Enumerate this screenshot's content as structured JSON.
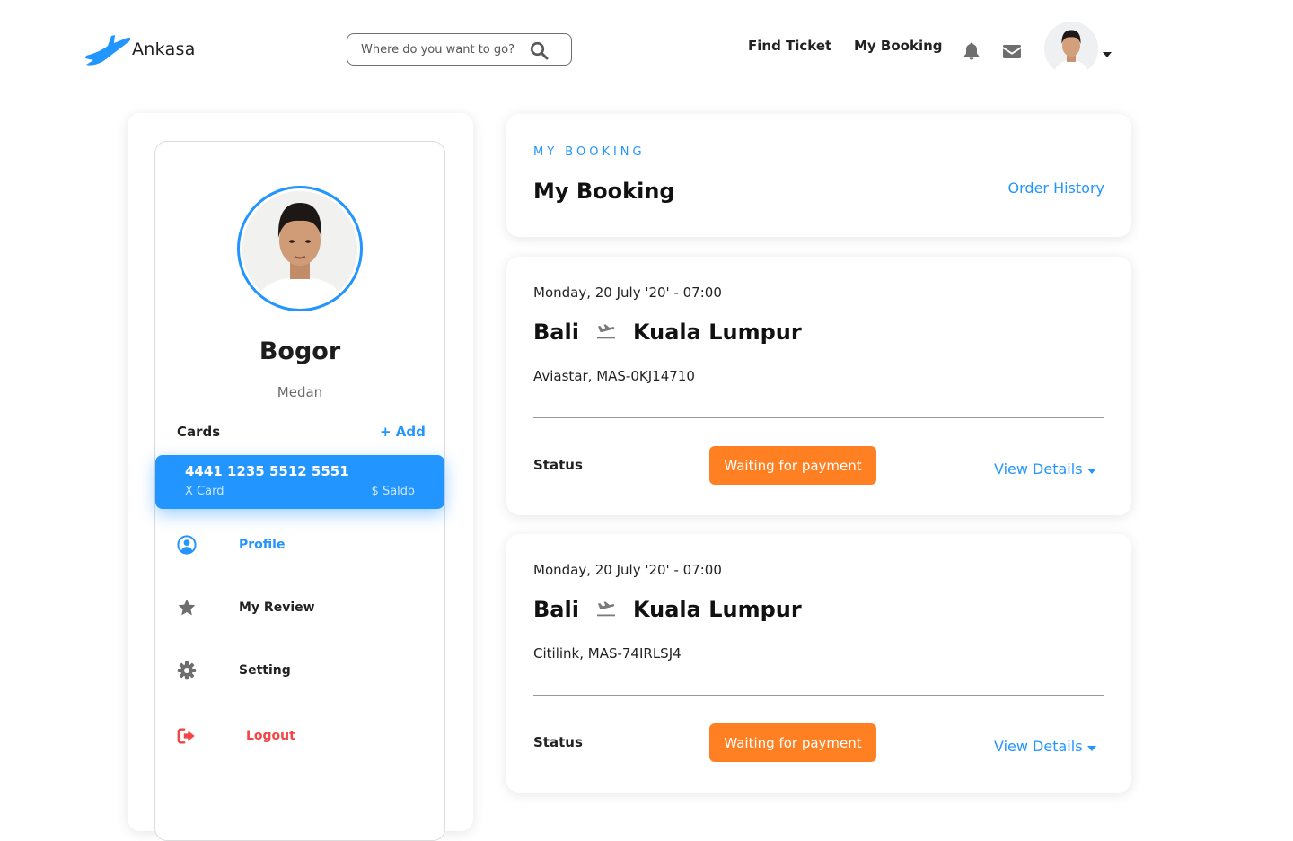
{
  "app": {
    "name": "Ankasa",
    "accent": "#2395ff",
    "status_color": "#ff7f23",
    "logout_color": "#f24545"
  },
  "search": {
    "placeholder": "Where do you want to go?",
    "icon": "search-icon"
  },
  "nav": {
    "find_ticket": "Find Ticket",
    "my_booking": "My Booking"
  },
  "header_icons": [
    "bell-icon",
    "mail-icon",
    "chevron-down-icon"
  ],
  "profile": {
    "name": "Bogor",
    "city": "Medan",
    "cards_label": "Cards",
    "add_label": "+ Add",
    "card": {
      "number": "4441 1235 5512 5551",
      "type": "X Card",
      "balance_label": "$ Saldo"
    }
  },
  "menu": [
    {
      "label": "Profile",
      "icon": "user-circle-icon"
    },
    {
      "label": "My Review",
      "icon": "star-icon"
    },
    {
      "label": "Setting",
      "icon": "gear-icon"
    },
    {
      "label": "Logout",
      "icon": "logout-icon"
    }
  ],
  "booking": {
    "eyebrow": "MY BOOKING",
    "title": "My Booking",
    "order_history": "Order History",
    "tickets": [
      {
        "date": "Monday, 20 July '20' - 07:00",
        "from": "Bali",
        "to": "Kuala Lumpur",
        "airline": "Aviastar, MAS-0KJ14710",
        "status_label": "Status",
        "status": "Waiting for payment",
        "details_label": "View Details"
      },
      {
        "date": "Monday, 20 July '20' - 07:00",
        "from": "Bali",
        "to": "Kuala Lumpur",
        "airline": "Citilink, MAS-74IRLSJ4",
        "status_label": "Status",
        "status": "Waiting for payment",
        "details_label": "View Details"
      }
    ]
  }
}
